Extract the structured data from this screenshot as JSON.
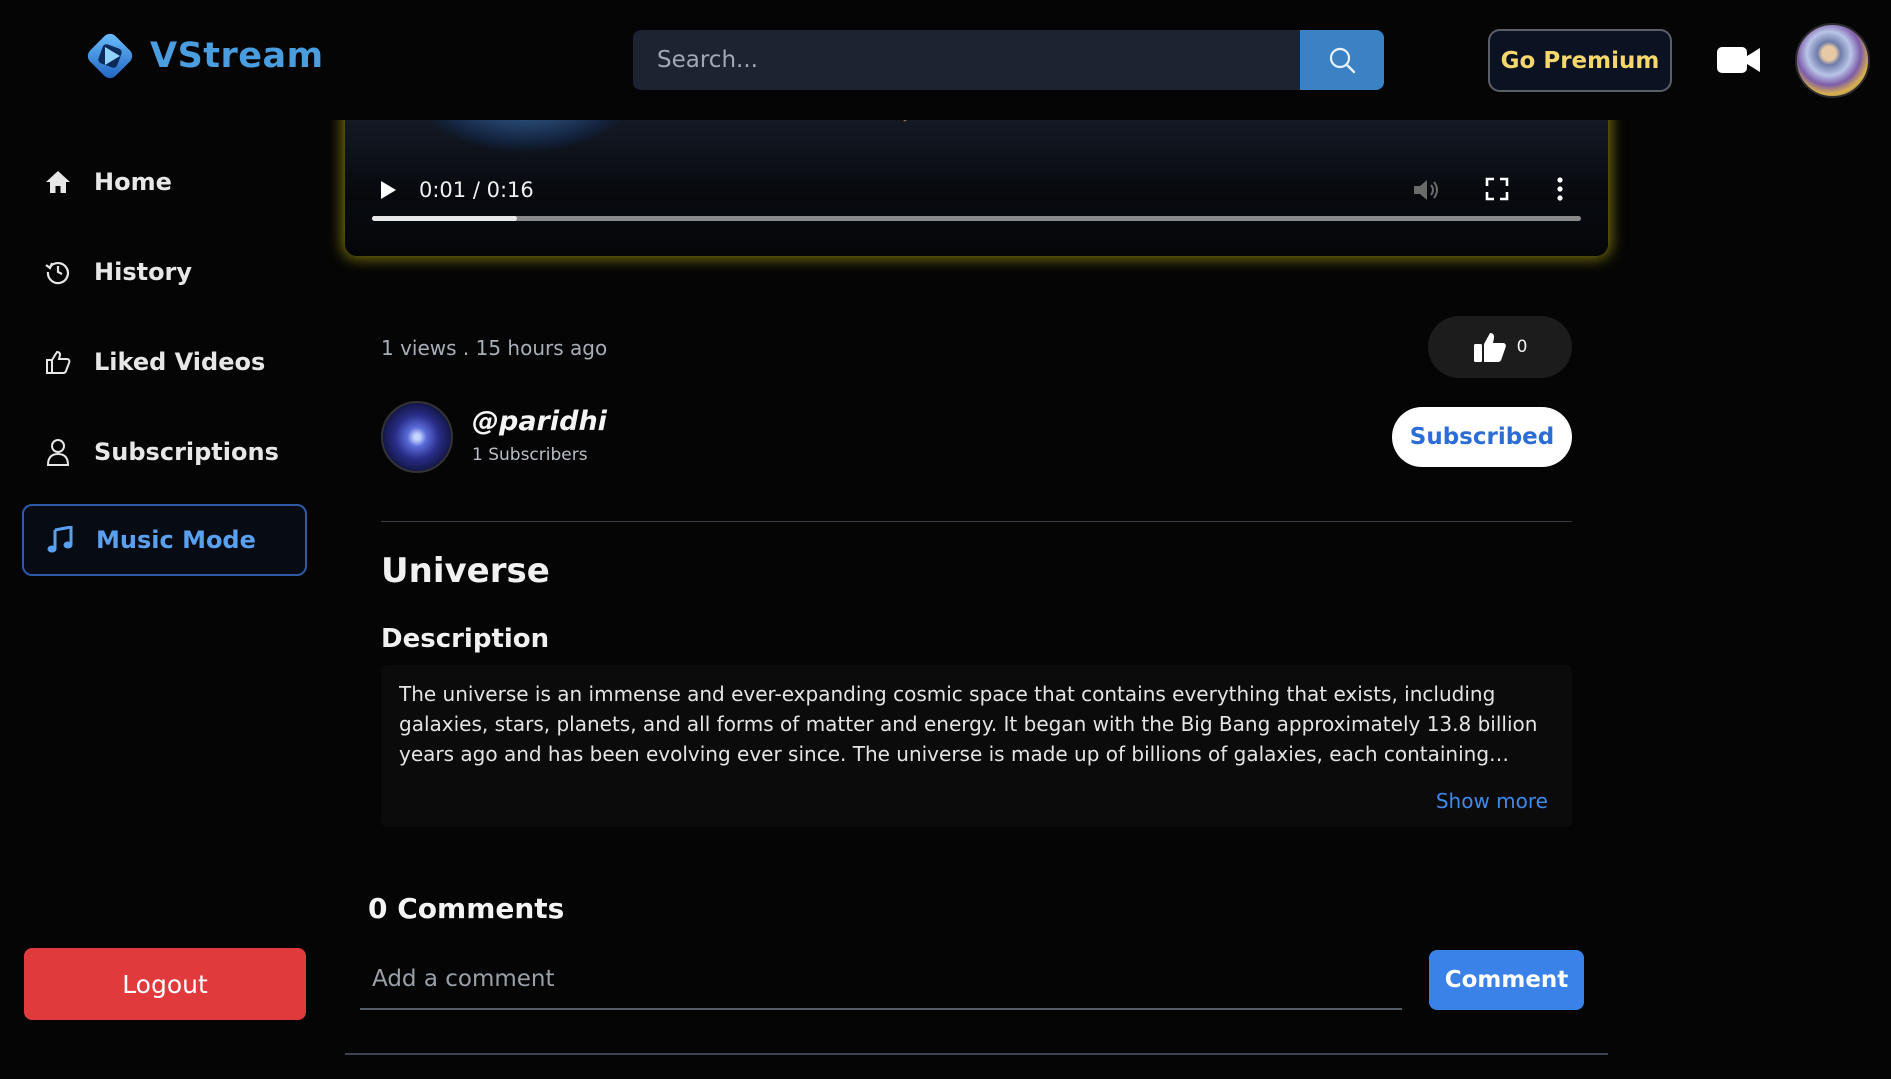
{
  "header": {
    "app_name": "VStream",
    "search_placeholder": "Search...",
    "premium_label": "Go Premium"
  },
  "sidebar": {
    "items": [
      {
        "label": "Home",
        "icon": "home-icon"
      },
      {
        "label": "History",
        "icon": "history-icon"
      },
      {
        "label": "Liked Videos",
        "icon": "thumbs-up-icon"
      },
      {
        "label": "Subscriptions",
        "icon": "user-icon"
      },
      {
        "label": "Music Mode",
        "icon": "music-note-icon",
        "active": true
      }
    ],
    "logout_label": "Logout"
  },
  "player": {
    "time": "0:01 / 0:16",
    "progress": 0.12
  },
  "video": {
    "meta": "1 views . 15 hours ago",
    "likes": "0",
    "channel_name": "@paridhi",
    "subscribers": "1 Subscribers",
    "subscribe_label": "Subscribed",
    "title": "Universe",
    "description_heading": "Description",
    "description": "The universe is an immense and ever-expanding cosmic space that contains everything that exists, including galaxies, stars, planets, and all forms of matter and energy. It began with the Big Bang approximately 13.8 billion years ago and has been evolving ever since. The universe is made up of billions of galaxies, each containing countless stars and planetary systems. In",
    "show_more_label": "Show more"
  },
  "comments": {
    "heading": "0 Comments",
    "placeholder": "Add a comment",
    "button_label": "Comment"
  },
  "colors": {
    "accent": "#4a9ee0",
    "premium_text": "#f5d76e",
    "logout": "#e03a3c",
    "player_glow": "#d6c814",
    "comment_button": "#3a82e8"
  }
}
